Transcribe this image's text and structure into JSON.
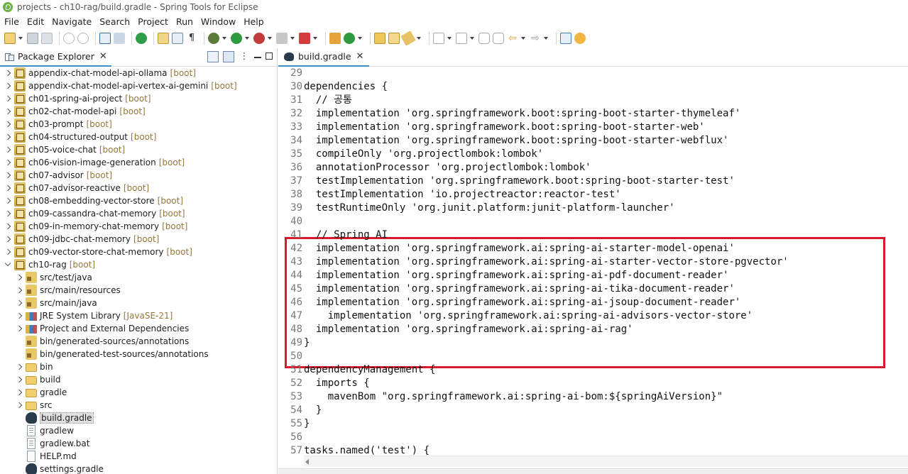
{
  "window": {
    "title": "projects - ch10-rag/build.gradle - Spring Tools for Eclipse"
  },
  "menu": [
    "File",
    "Edit",
    "Navigate",
    "Search",
    "Project",
    "Run",
    "Window",
    "Help"
  ],
  "package_explorer": {
    "tab_label": "Package Explorer",
    "items": [
      {
        "label": "appendix-chat-model-api-ollama",
        "suffix": "[boot]",
        "indent": 0,
        "expander": "right",
        "icon": "project-icon"
      },
      {
        "label": "appendix-chat-model-api-vertex-ai-gemini",
        "suffix": "[boot]",
        "indent": 0,
        "expander": "right",
        "icon": "project-icon"
      },
      {
        "label": "ch01-spring-ai-project",
        "suffix": "[boot]",
        "indent": 0,
        "expander": "right",
        "icon": "project-icon"
      },
      {
        "label": "ch02-chat-model-api",
        "suffix": "[boot]",
        "indent": 0,
        "expander": "right",
        "icon": "project-icon"
      },
      {
        "label": "ch03-prompt",
        "suffix": "[boot]",
        "indent": 0,
        "expander": "right",
        "icon": "project-icon"
      },
      {
        "label": "ch04-structured-output",
        "suffix": "[boot]",
        "indent": 0,
        "expander": "right",
        "icon": "project-icon"
      },
      {
        "label": "ch05-voice-chat",
        "suffix": "[boot]",
        "indent": 0,
        "expander": "right",
        "icon": "project-icon"
      },
      {
        "label": "ch06-vision-image-generation",
        "suffix": "[boot]",
        "indent": 0,
        "expander": "right",
        "icon": "project-icon"
      },
      {
        "label": "ch07-advisor",
        "suffix": "[boot]",
        "indent": 0,
        "expander": "right",
        "icon": "project-icon"
      },
      {
        "label": "ch07-advisor-reactive",
        "suffix": "[boot]",
        "indent": 0,
        "expander": "right",
        "icon": "project-icon"
      },
      {
        "label": "ch08-embedding-vector-store",
        "suffix": "[boot]",
        "indent": 0,
        "expander": "right",
        "icon": "project-icon"
      },
      {
        "label": "ch09-cassandra-chat-memory",
        "suffix": "[boot]",
        "indent": 0,
        "expander": "right",
        "icon": "project-icon"
      },
      {
        "label": "ch09-in-memory-chat-memory",
        "suffix": "[boot]",
        "indent": 0,
        "expander": "right",
        "icon": "project-icon"
      },
      {
        "label": "ch09-jdbc-chat-memory",
        "suffix": "[boot]",
        "indent": 0,
        "expander": "right",
        "icon": "project-icon"
      },
      {
        "label": "ch09-vector-store-chat-memory",
        "suffix": "[boot]",
        "indent": 0,
        "expander": "right",
        "icon": "project-icon"
      },
      {
        "label": "ch10-rag",
        "suffix": "[boot]",
        "indent": 0,
        "expander": "down",
        "icon": "project-icon"
      },
      {
        "label": "src/test/java",
        "suffix": "",
        "indent": 1,
        "expander": "right",
        "icon": "source-folder-icon"
      },
      {
        "label": "src/main/resources",
        "suffix": "",
        "indent": 1,
        "expander": "right",
        "icon": "source-folder-icon"
      },
      {
        "label": "src/main/java",
        "suffix": "",
        "indent": 1,
        "expander": "right",
        "icon": "source-folder-icon"
      },
      {
        "label": "JRE System Library",
        "suffix": "[JavaSE-21]",
        "indent": 1,
        "expander": "right",
        "icon": "library-icon"
      },
      {
        "label": "Project and External Dependencies",
        "suffix": "",
        "indent": 1,
        "expander": "right",
        "icon": "library-icon"
      },
      {
        "label": "bin/generated-sources/annotations",
        "suffix": "",
        "indent": 1,
        "expander": "none",
        "icon": "source-folder-icon"
      },
      {
        "label": "bin/generated-test-sources/annotations",
        "suffix": "",
        "indent": 1,
        "expander": "none",
        "icon": "source-folder-icon"
      },
      {
        "label": "bin",
        "suffix": "",
        "indent": 1,
        "expander": "right",
        "icon": "folder-icon"
      },
      {
        "label": "build",
        "suffix": "",
        "indent": 1,
        "expander": "right",
        "icon": "folder-icon"
      },
      {
        "label": "gradle",
        "suffix": "",
        "indent": 1,
        "expander": "right",
        "icon": "folder-icon"
      },
      {
        "label": "src",
        "suffix": "",
        "indent": 1,
        "expander": "right",
        "icon": "folder-icon"
      },
      {
        "label": "build.gradle",
        "suffix": "",
        "indent": 1,
        "expander": "none",
        "icon": "gradle-file-icon",
        "selected": true
      },
      {
        "label": "gradlew",
        "suffix": "",
        "indent": 1,
        "expander": "none",
        "icon": "file-icon"
      },
      {
        "label": "gradlew.bat",
        "suffix": "",
        "indent": 1,
        "expander": "none",
        "icon": "file-icon"
      },
      {
        "label": "HELP.md",
        "suffix": "",
        "indent": 1,
        "expander": "none",
        "icon": "markdown-file-icon"
      },
      {
        "label": "settings.gradle",
        "suffix": "",
        "indent": 1,
        "expander": "none",
        "icon": "gradle-file-icon"
      }
    ]
  },
  "editor": {
    "tab_label": "build.gradle",
    "lines": [
      {
        "n": "29",
        "text": ""
      },
      {
        "n": "30",
        "text": "dependencies {"
      },
      {
        "n": "31",
        "text": "  // 공통"
      },
      {
        "n": "32",
        "text": "  implementation 'org.springframework.boot:spring-boot-starter-thymeleaf'"
      },
      {
        "n": "33",
        "text": "  implementation 'org.springframework.boot:spring-boot-starter-web'"
      },
      {
        "n": "34",
        "text": "  implementation 'org.springframework.boot:spring-boot-starter-webflux'"
      },
      {
        "n": "35",
        "text": "  compileOnly 'org.projectlombok:lombok'"
      },
      {
        "n": "36",
        "text": "  annotationProcessor 'org.projectlombok:lombok'"
      },
      {
        "n": "37",
        "text": "  testImplementation 'org.springframework.boot:spring-boot-starter-test'"
      },
      {
        "n": "38",
        "text": "  testImplementation 'io.projectreactor:reactor-test'"
      },
      {
        "n": "39",
        "text": "  testRuntimeOnly 'org.junit.platform:junit-platform-launcher'"
      },
      {
        "n": "40",
        "text": ""
      },
      {
        "n": "41",
        "text": "  // Spring AI"
      },
      {
        "n": "42",
        "text": "  implementation 'org.springframework.ai:spring-ai-starter-model-openai'"
      },
      {
        "n": "43",
        "text": "  implementation 'org.springframework.ai:spring-ai-starter-vector-store-pgvector'"
      },
      {
        "n": "44",
        "text": "  implementation 'org.springframework.ai:spring-ai-pdf-document-reader'"
      },
      {
        "n": "45",
        "text": "  implementation 'org.springframework.ai:spring-ai-tika-document-reader'"
      },
      {
        "n": "46",
        "text": "  implementation 'org.springframework.ai:spring-ai-jsoup-document-reader'"
      },
      {
        "n": "47",
        "text": "    implementation 'org.springframework.ai:spring-ai-advisors-vector-store'"
      },
      {
        "n": "48",
        "text": "  implementation 'org.springframework.ai:spring-ai-rag'"
      },
      {
        "n": "49",
        "text": "}"
      },
      {
        "n": "50",
        "text": ""
      },
      {
        "n": "51",
        "text": "dependencyManagement {"
      },
      {
        "n": "52",
        "text": "  imports {"
      },
      {
        "n": "53",
        "text": "    mavenBom \"org.springframework.ai:spring-ai-bom:${springAiVersion}\""
      },
      {
        "n": "54",
        "text": "  }"
      },
      {
        "n": "55",
        "text": "}"
      },
      {
        "n": "56",
        "text": ""
      },
      {
        "n": "57",
        "text": "tasks.named('test') {"
      }
    ]
  },
  "colors": {
    "highlight_border": "#d81a2a",
    "active_tab_underline": "#3d8ec9",
    "boot_decoration": "#95783c",
    "line_number": "#787878"
  }
}
